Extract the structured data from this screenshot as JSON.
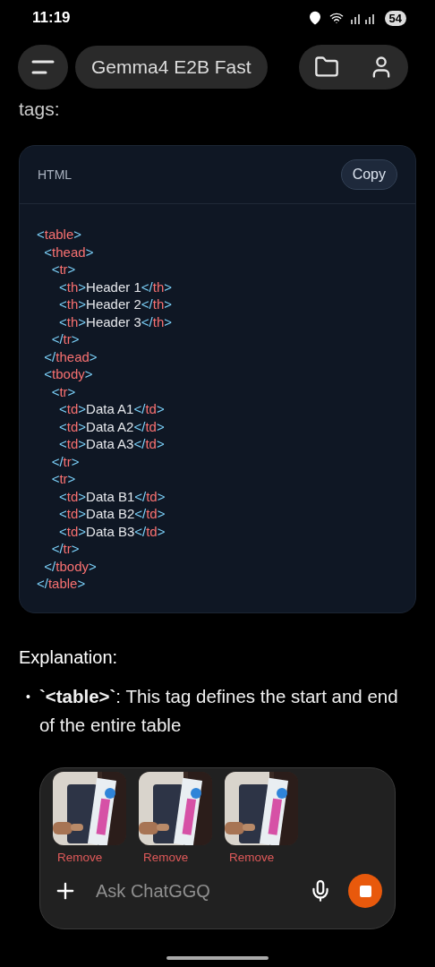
{
  "status_bar": {
    "time": "11:19",
    "battery": "54"
  },
  "header": {
    "model": "Gemma4 E2B Fast"
  },
  "message": {
    "intro_tail": "tags:",
    "code_block": {
      "language": "HTML",
      "copy_label": "Copy",
      "lines": [
        "<table>",
        "  <thead>",
        "    <tr>",
        "      <th>Header 1</th>",
        "      <th>Header 2</th>",
        "      <th>Header 3</th>",
        "    </tr>",
        "  </thead>",
        "  <tbody>",
        "    <tr>",
        "      <td>Data A1</td>",
        "      <td>Data A2</td>",
        "      <td>Data A3</td>",
        "    </tr>",
        "    <tr>",
        "      <td>Data B1</td>",
        "      <td>Data B2</td>",
        "      <td>Data B3</td>",
        "    </tr>",
        "  </tbody>",
        "</table>"
      ]
    },
    "heading": "Explanation:",
    "bullets": [
      {
        "marker": "•",
        "text": "**`<table>`**: This tag defines the start and end of the entire table"
      }
    ]
  },
  "composer": {
    "attachments": [
      {
        "kind": "picture",
        "remove_label": "Remove"
      },
      {
        "kind": "picture",
        "remove_label": "Remove"
      },
      {
        "kind": "picture",
        "remove_label": "Remove"
      }
    ],
    "placeholder": "Ask ChatGGQ"
  }
}
